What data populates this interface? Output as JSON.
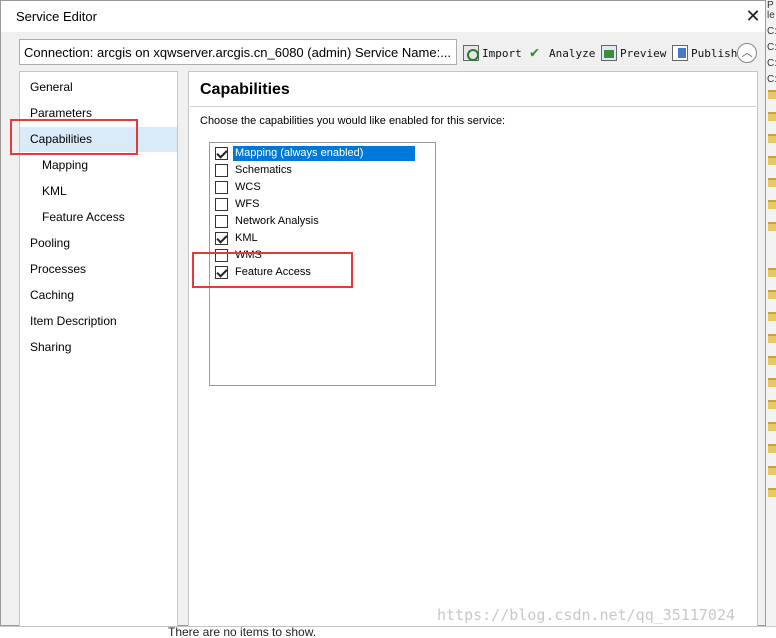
{
  "dialog": {
    "title": "Service Editor",
    "close_glyph": "✕"
  },
  "toolbar": {
    "connection_text": "Connection: arcgis on xqwserver.arcgis.cn_6080 (admin)   Service Name:...",
    "import_label": "Import",
    "analyze_label": "Analyze",
    "preview_label": "Preview",
    "publish_label": "Publish",
    "collapse_glyph": "︿"
  },
  "nav": {
    "items": [
      {
        "label": "General",
        "sub": false,
        "selected": false
      },
      {
        "label": "Parameters",
        "sub": false,
        "selected": false
      },
      {
        "label": "Capabilities",
        "sub": false,
        "selected": true
      },
      {
        "label": "Mapping",
        "sub": true,
        "selected": false
      },
      {
        "label": "KML",
        "sub": true,
        "selected": false
      },
      {
        "label": "Feature Access",
        "sub": true,
        "selected": false
      },
      {
        "label": "Pooling",
        "sub": false,
        "selected": false
      },
      {
        "label": "Processes",
        "sub": false,
        "selected": false
      },
      {
        "label": "Caching",
        "sub": false,
        "selected": false
      },
      {
        "label": "Item Description",
        "sub": false,
        "selected": false
      },
      {
        "label": "Sharing",
        "sub": false,
        "selected": false
      }
    ]
  },
  "capabilities": {
    "title": "Capabilities",
    "description": "Choose the capabilities you would like enabled for this service:",
    "items": [
      {
        "label": "Mapping (always enabled)",
        "checked": true,
        "highlighted": true
      },
      {
        "label": "Schematics",
        "checked": false,
        "highlighted": false
      },
      {
        "label": "WCS",
        "checked": false,
        "highlighted": false
      },
      {
        "label": "WFS",
        "checked": false,
        "highlighted": false
      },
      {
        "label": "Network Analysis",
        "checked": false,
        "highlighted": false
      },
      {
        "label": "KML",
        "checked": true,
        "highlighted": false
      },
      {
        "label": "WMS",
        "checked": false,
        "highlighted": false
      },
      {
        "label": "Feature Access",
        "checked": true,
        "highlighted": false
      }
    ]
  },
  "background": {
    "bottom_text": "There are no items to show.",
    "right_edge_chars": [
      "P",
      "le",
      "C:",
      "C:",
      "C:",
      "C:"
    ]
  },
  "watermark": "https://blog.csdn.net/qq_35117024",
  "colors": {
    "selection_blue": "#0078d7",
    "nav_selected": "#d9ebf8",
    "annotation_red": "#e53a3a"
  }
}
